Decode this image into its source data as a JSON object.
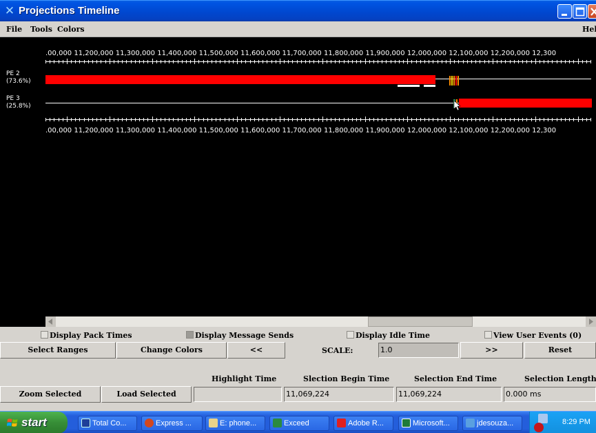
{
  "window": {
    "title": "Projections Timeline"
  },
  "menu": {
    "items": [
      "File",
      "Tools",
      "Colors"
    ],
    "help": "Help"
  },
  "timeline": {
    "axis_labels_top": ".00,000 11,200,000 11,300,000 11,400,000 11,500,000 11,600,000 11,700,000 11,800,000 11,900,000 12,000,000 12,100,000 12,200,000 12,300",
    "axis_labels_bottom": ".00,000 11,200,000 11,300,000 11,400,000 11,500,000 11,600,000 11,700,000 11,800,000 11,900,000 12,000,000 12,100,000 12,200,000 12,300",
    "rows": [
      {
        "pe": "PE 2",
        "util": "(73.6%)"
      },
      {
        "pe": "PE 3",
        "util": "(25.8%)"
      }
    ],
    "colors": {
      "busy": "#ff0000",
      "idle_line": "#ffffff",
      "background": "#000000",
      "entry_orange": "#ff8c00",
      "entry_green": "#2e8b57",
      "entry_yellow": "#ffd700"
    }
  },
  "checkboxes": {
    "pack_times": "Display Pack Times",
    "message_sends": "Display Message Sends",
    "idle_time": "Display Idle Time",
    "user_events": "View User Events (0)"
  },
  "buttons": {
    "select_ranges": "Select Ranges",
    "change_colors": "Change Colors",
    "prev": "<<",
    "scale_label": "SCALE:",
    "scale_value": "1.0",
    "next": ">>",
    "reset": "Reset",
    "zoom_selected": "Zoom Selected",
    "load_selected": "Load Selected"
  },
  "selection": {
    "highlight_label": "Highlight Time",
    "begin_label": "Slection Begin Time",
    "end_label": "Selection End Time",
    "length_label": "Selection Length",
    "highlight_value": "",
    "begin_value": "11,069,224",
    "end_value": "11,069,224",
    "length_value": "0.000 ms"
  },
  "taskbar": {
    "start": "start",
    "tasks": [
      {
        "label": "Total Co...",
        "icon": "floppy-icon"
      },
      {
        "label": "Express ...",
        "icon": "express-icon"
      },
      {
        "label": "E: phone...",
        "icon": "phone-folder-icon"
      },
      {
        "label": "Exceed",
        "icon": "exceed-icon"
      },
      {
        "label": "Adobe R...",
        "icon": "adobe-icon"
      },
      {
        "label": "Microsoft...",
        "icon": "excel-icon"
      },
      {
        "label": "jdesouza...",
        "icon": "remote-icon"
      }
    ],
    "clock": "8:29 PM"
  }
}
